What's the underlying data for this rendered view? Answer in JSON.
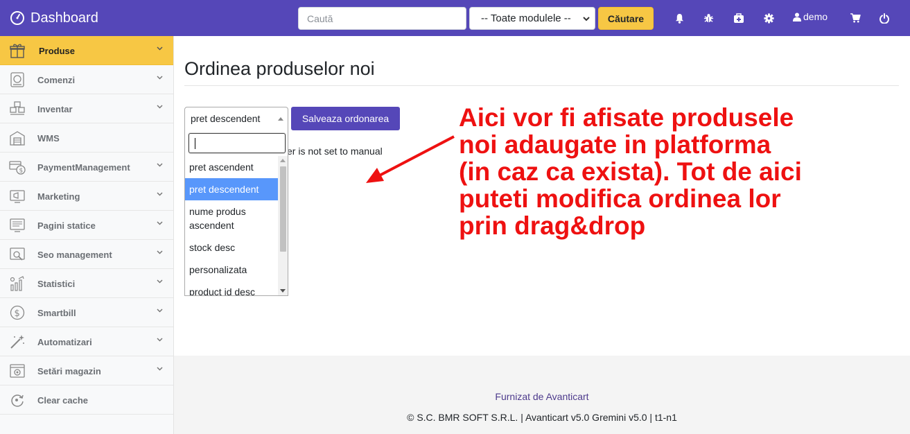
{
  "topbar": {
    "brand": "Dashboard",
    "search_placeholder": "Caută",
    "module_select": "-- Toate modulele --",
    "search_button": "Căutare",
    "user": "demo",
    "colors": {
      "bar": "#5547b8",
      "accent": "#f7c744"
    },
    "icons": [
      "bell-icon",
      "bug-icon",
      "first-aid-icon",
      "gear-icon",
      "user-icon",
      "cart-icon",
      "power-icon"
    ]
  },
  "sidebar": {
    "items": [
      {
        "label": "Produse",
        "icon": "gift-icon",
        "active": true,
        "expandable": true
      },
      {
        "label": "Comenzi",
        "icon": "orders-icon",
        "active": false,
        "expandable": true
      },
      {
        "label": "Inventar",
        "icon": "boxes-icon",
        "active": false,
        "expandable": true
      },
      {
        "label": "WMS",
        "icon": "warehouse-icon",
        "active": false,
        "expandable": false
      },
      {
        "label": "PaymentManagement",
        "icon": "payment-icon",
        "active": false,
        "expandable": true
      },
      {
        "label": "Marketing",
        "icon": "marketing-icon",
        "active": false,
        "expandable": true
      },
      {
        "label": "Pagini statice",
        "icon": "pages-icon",
        "active": false,
        "expandable": true
      },
      {
        "label": "Seo management",
        "icon": "seo-icon",
        "active": false,
        "expandable": true
      },
      {
        "label": "Statistici",
        "icon": "stats-icon",
        "active": false,
        "expandable": true
      },
      {
        "label": "Smartbill",
        "icon": "dollar-icon",
        "active": false,
        "expandable": true
      },
      {
        "label": "Automatizari",
        "icon": "magic-wand-icon",
        "active": false,
        "expandable": true
      },
      {
        "label": "Setări magazin",
        "icon": "store-settings-icon",
        "active": false,
        "expandable": true
      },
      {
        "label": "Clear cache",
        "icon": "clear-cache-icon",
        "active": false,
        "expandable": false
      }
    ]
  },
  "main": {
    "title": "Ordinea produselor noi",
    "order_select": "pret descendent",
    "save_button": "Salveaza ordonarea",
    "hidden_note": "er is not set to manual",
    "dropdown": {
      "search_value": "",
      "options": [
        "pret ascendent",
        "pret descendent",
        "nume produs ascendent",
        "stock desc",
        "personalizata",
        "product id desc"
      ],
      "selected": "pret descendent"
    }
  },
  "annotation": {
    "lines": [
      "Aici vor fi afisate produsele",
      "noi adaugate in platforma",
      "(in caz ca exista). Tot de aici",
      "puteti modifica ordinea lor",
      "prin drag&drop"
    ],
    "color": "#ee1111"
  },
  "footer": {
    "link": "Furnizat de Avanticart",
    "copyright": "© S.C. BMR SOFT S.R.L. | Avanticart v5.0 Gremini v5.0 | t1-n1"
  }
}
